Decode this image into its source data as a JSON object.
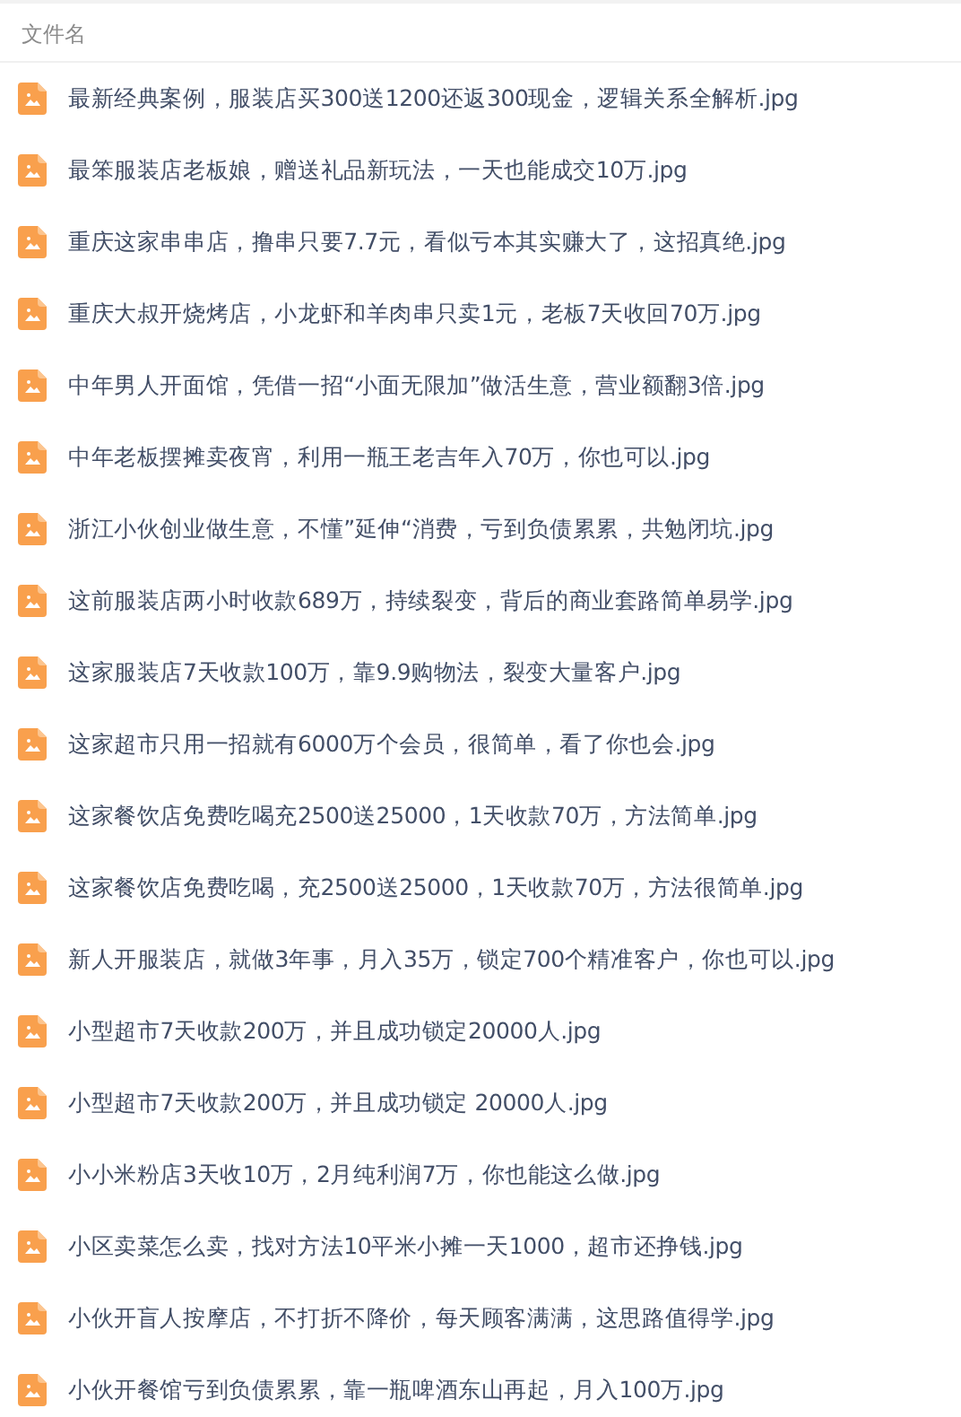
{
  "table": {
    "columns": [
      "文件名"
    ],
    "rows": [
      {
        "name": "最新经典案例，服装店买300送1200还返300现金，逻辑关系全解析.jpg"
      },
      {
        "name": "最笨服装店老板娘，赠送礼品新玩法，一天也能成交10万.jpg"
      },
      {
        "name": "重庆这家串串店，撸串只要7.7元，看似亏本其实赚大了，这招真绝.jpg"
      },
      {
        "name": "重庆大叔开烧烤店，小龙虾和羊肉串只卖1元，老板7天收回70万.jpg"
      },
      {
        "name": "中年男人开面馆，凭借一招“小面无限加”做活生意，营业额翻3倍.jpg"
      },
      {
        "name": "中年老板摆摊卖夜宵，利用一瓶王老吉年入70万，你也可以.jpg"
      },
      {
        "name": "浙江小伙创业做生意，不懂”延伸“消费，亏到负债累累，共勉闭坑.jpg"
      },
      {
        "name": "这前服装店两小时收款689万，持续裂变，背后的商业套路简单易学.jpg"
      },
      {
        "name": "这家服装店7天收款100万，靠9.9购物法，裂变大量客户.jpg"
      },
      {
        "name": "这家超市只用一招就有6000万个会员，很简单，看了你也会.jpg"
      },
      {
        "name": "这家餐饮店免费吃喝充2500送25000，1天收款70万，方法简单.jpg"
      },
      {
        "name": "这家餐饮店免费吃喝，充2500送25000，1天收款70万，方法很简单.jpg"
      },
      {
        "name": "新人开服装店，就做3年事，月入35万，锁定700个精准客户，你也可以.jpg"
      },
      {
        "name": "小型超市7天收款200万，并且成功锁定20000人.jpg"
      },
      {
        "name": "小型超市7天收款200万，并且成功锁定 20000人.jpg"
      },
      {
        "name": "小小米粉店3天收10万，2月纯利润7万，你也能这么做.jpg"
      },
      {
        "name": "小区卖菜怎么卖，找对方法10平米小摊一天1000，超市还挣钱.jpg"
      },
      {
        "name": "小伙开盲人按摩店，不打折不降价，每天顾客满满，这思路值得学.jpg"
      },
      {
        "name": "小伙开餐馆亏到负债累累，靠一瓶啤酒东山再起，月入100万.jpg"
      }
    ]
  }
}
